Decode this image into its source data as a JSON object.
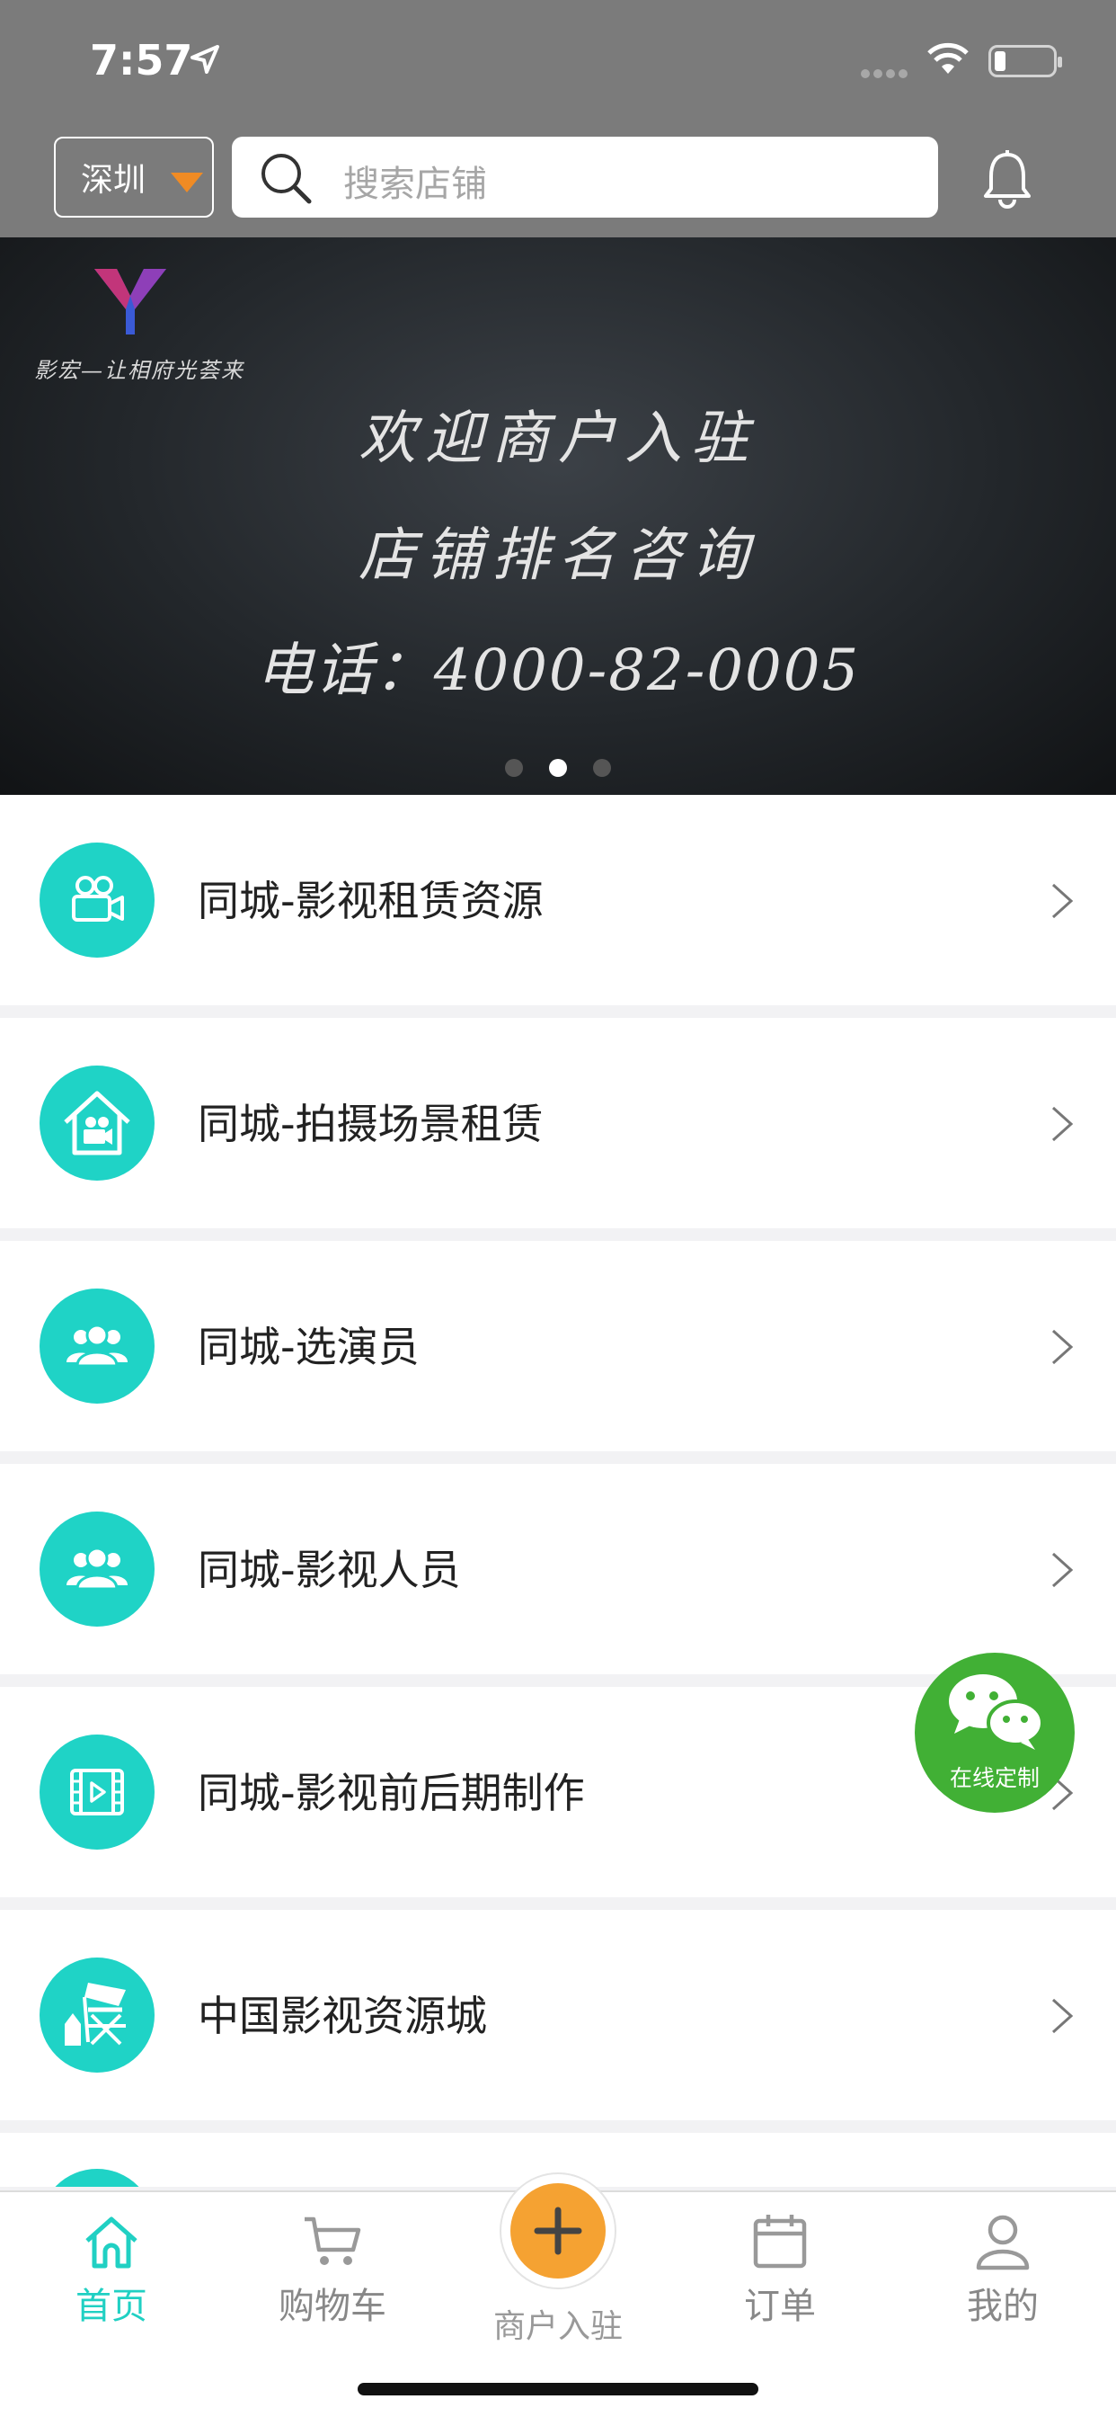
{
  "status_bar": {
    "time": "7:57"
  },
  "header": {
    "city": "深圳",
    "search_placeholder": "搜索店铺",
    "accent_color": "#f08b24"
  },
  "banner": {
    "logo_text": "影宏—让相府光荟来",
    "lines": [
      "欢迎商户入驻",
      "店铺排名咨询",
      "电话：4000-82-0005"
    ],
    "pagination": {
      "total": 3,
      "active": 2
    }
  },
  "list": {
    "icon_color": "#1fd3c6",
    "items": [
      {
        "label": "同城-影视租赁资源",
        "icon": "video-camera-icon"
      },
      {
        "label": "同城-拍摄场景租赁",
        "icon": "studio-house-icon"
      },
      {
        "label": "同城-选演员",
        "icon": "people-group-icon"
      },
      {
        "label": "同城-影视人员",
        "icon": "people-group-icon"
      },
      {
        "label": "同城-影视前后期制作",
        "icon": "film-play-icon"
      },
      {
        "label": "中国影视资源城",
        "icon": "director-chair-icon"
      }
    ]
  },
  "floating": {
    "label": "在线定制",
    "icon": "wechat-icon",
    "color": "#41b035"
  },
  "tabbar": {
    "tabs": [
      {
        "label": "首页",
        "icon": "home-icon",
        "active": true
      },
      {
        "label": "购物车",
        "icon": "cart-icon",
        "active": false
      },
      {
        "label": "商户入驻",
        "icon": "plus-icon",
        "active": false
      },
      {
        "label": "订单",
        "icon": "calendar-icon",
        "active": false
      },
      {
        "label": "我的",
        "icon": "user-icon",
        "active": false
      }
    ],
    "active_color": "#20d0c3",
    "center_color": "#f5a232"
  }
}
